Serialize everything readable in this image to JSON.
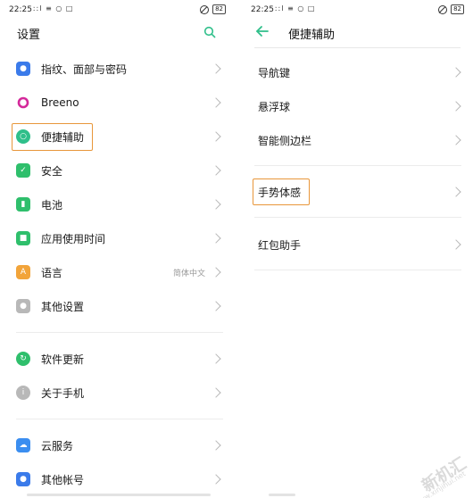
{
  "left": {
    "status": {
      "time": "22:25",
      "signal": "ːːl ≡ ○ □",
      "battery": "82"
    },
    "title": "设置",
    "items": [
      {
        "label": "指纹、面部与密码",
        "value": "",
        "icon": "person-lock-icon",
        "color": "#3b7bea"
      },
      {
        "label": "Breeno",
        "value": "",
        "icon": "breeno-icon",
        "color": "#d4299a"
      },
      {
        "label": "便捷辅助",
        "value": "",
        "icon": "accessibility-icon",
        "color": "#2fbf8a"
      },
      {
        "label": "安全",
        "value": "",
        "icon": "shield-icon",
        "color": "#2fbf6c"
      },
      {
        "label": "电池",
        "value": "",
        "icon": "battery-icon",
        "color": "#2fbf6c"
      },
      {
        "label": "应用使用时间",
        "value": "",
        "icon": "hourglass-icon",
        "color": "#2fbf6c"
      },
      {
        "label": "语言",
        "value": "简体中文",
        "icon": "language-icon",
        "color": "#f2a43a"
      },
      {
        "label": "其他设置",
        "value": "",
        "icon": "gear-icon",
        "color": "#b8b8b8"
      },
      {
        "label": "软件更新",
        "value": "",
        "icon": "update-icon",
        "color": "#2fbf6c"
      },
      {
        "label": "关于手机",
        "value": "",
        "icon": "info-icon",
        "color": "#b8b8b8"
      },
      {
        "label": "云服务",
        "value": "",
        "icon": "cloud-icon",
        "color": "#3b8ef0"
      },
      {
        "label": "其他帐号",
        "value": "",
        "icon": "account-icon",
        "color": "#3b7bea"
      }
    ]
  },
  "right": {
    "status": {
      "time": "22:25",
      "signal": "ːːl ≡ ○ □",
      "battery": "82"
    },
    "title": "便捷辅助",
    "items": [
      {
        "label": "导航键"
      },
      {
        "label": "悬浮球"
      },
      {
        "label": "智能侧边栏"
      },
      {
        "label": "手势体感"
      },
      {
        "label": "红包助手"
      }
    ]
  },
  "watermark": {
    "text": "新机汇",
    "sub": "www.xinjihui.net"
  },
  "colors": {
    "accent": "#2fbf8a",
    "highlight": "#e8963a"
  }
}
